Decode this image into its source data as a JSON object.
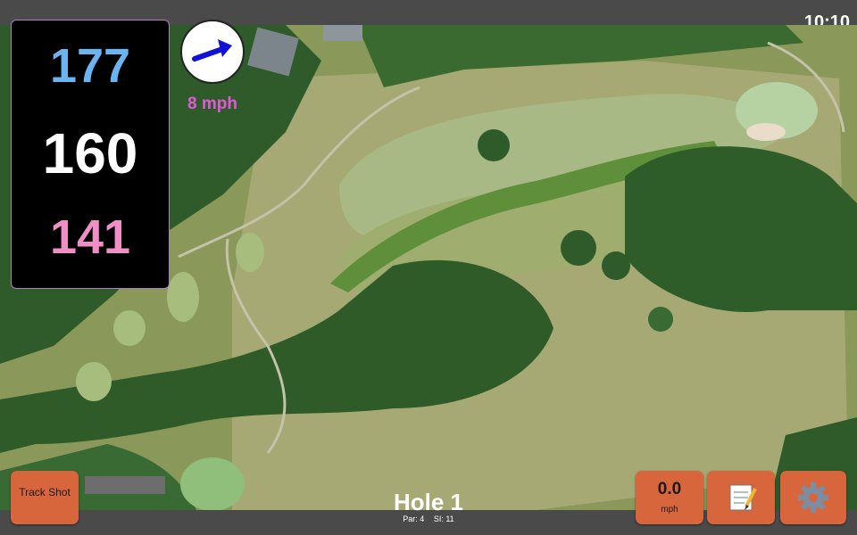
{
  "status": {
    "time": "10:10"
  },
  "distances": {
    "back": "177",
    "middle": "160",
    "front": "141",
    "colors": {
      "back": "#6ab4f0",
      "middle": "#ffffff",
      "front": "#f08fc6"
    }
  },
  "wind": {
    "direction_icon": "arrow-icon",
    "speed_label": "8 mph",
    "speed_color": "#e05ad7",
    "value": "0.0",
    "unit": "mph"
  },
  "hole": {
    "title": "Hole 1",
    "par": "Par: 4",
    "si": "SI: 11"
  },
  "buttons": {
    "track_shot": "Track Shot",
    "notes_icon": "notepad-icon",
    "settings_icon": "gear-icon"
  },
  "colors": {
    "button": "#d8663c",
    "panel_border": "#b07cc7"
  }
}
